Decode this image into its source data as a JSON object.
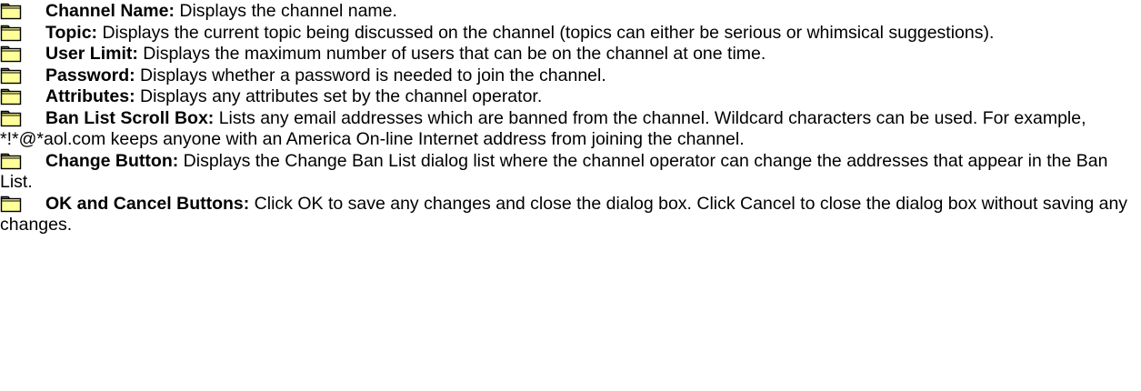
{
  "icon": "folder-icon",
  "colors": {
    "icon_fill": "#ffff99",
    "icon_stroke": "#000000"
  },
  "items": [
    {
      "term": "Channel Name:",
      "description": " Displays the channel name."
    },
    {
      "term": "Topic:",
      "description": " Displays the current topic being discussed on the channel (topics can either be serious or whimsical suggestions)."
    },
    {
      "term": "User Limit:",
      "description": " Displays the maximum number of users that can be on the channel at one time."
    },
    {
      "term": "Password:",
      "description": " Displays whether a password is needed to join the channel."
    },
    {
      "term": "Attributes:",
      "description": " Displays any attributes set by the channel operator."
    },
    {
      "term": "Ban List Scroll Box:",
      "description": " Lists any email addresses which are banned from the channel. Wildcard characters can be used. For example, *!*@*aol.com keeps anyone with an America On-line Internet address from joining the channel."
    },
    {
      "term": "Change Button:",
      "description": " Displays the Change Ban List dialog list where the channel operator can change the addresses that appear in the Ban List."
    },
    {
      "term": "OK and Cancel Buttons:",
      "description": " Click OK to save any changes and close the dialog box. Click Cancel to close the dialog box without saving any changes."
    }
  ]
}
